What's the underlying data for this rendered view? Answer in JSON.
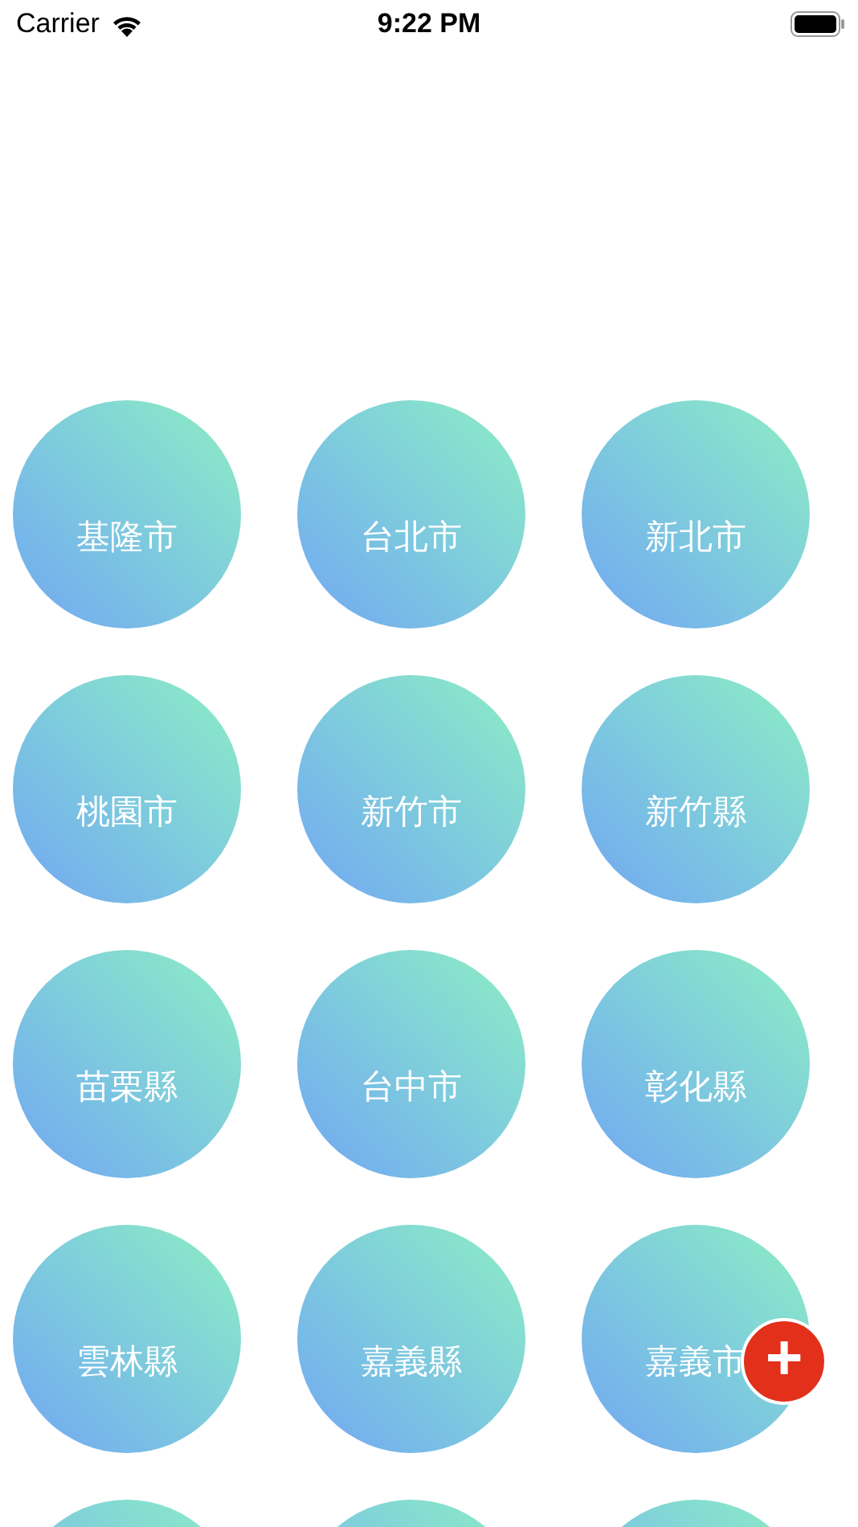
{
  "status_bar": {
    "carrier": "Carrier",
    "time": "9:22 PM"
  },
  "cities": [
    {
      "kind": "city",
      "name": "基隆市"
    },
    {
      "kind": "city",
      "name": "台北市"
    },
    {
      "kind": "city",
      "name": "新北市"
    },
    {
      "kind": "city",
      "name": "桃園市"
    },
    {
      "kind": "city",
      "name": "新竹市"
    },
    {
      "kind": "city",
      "name": "新竹縣"
    },
    {
      "kind": "city",
      "name": "苗栗縣"
    },
    {
      "kind": "city",
      "name": "台中市"
    },
    {
      "kind": "city",
      "name": "彰化縣"
    },
    {
      "kind": "city",
      "name": "雲林縣"
    },
    {
      "kind": "city",
      "name": "嘉義縣"
    },
    {
      "kind": "city",
      "name": "嘉義市"
    },
    {
      "kind": "partial"
    },
    {
      "kind": "partial"
    },
    {
      "kind": "partial"
    }
  ],
  "fab": {
    "label": "+"
  }
}
